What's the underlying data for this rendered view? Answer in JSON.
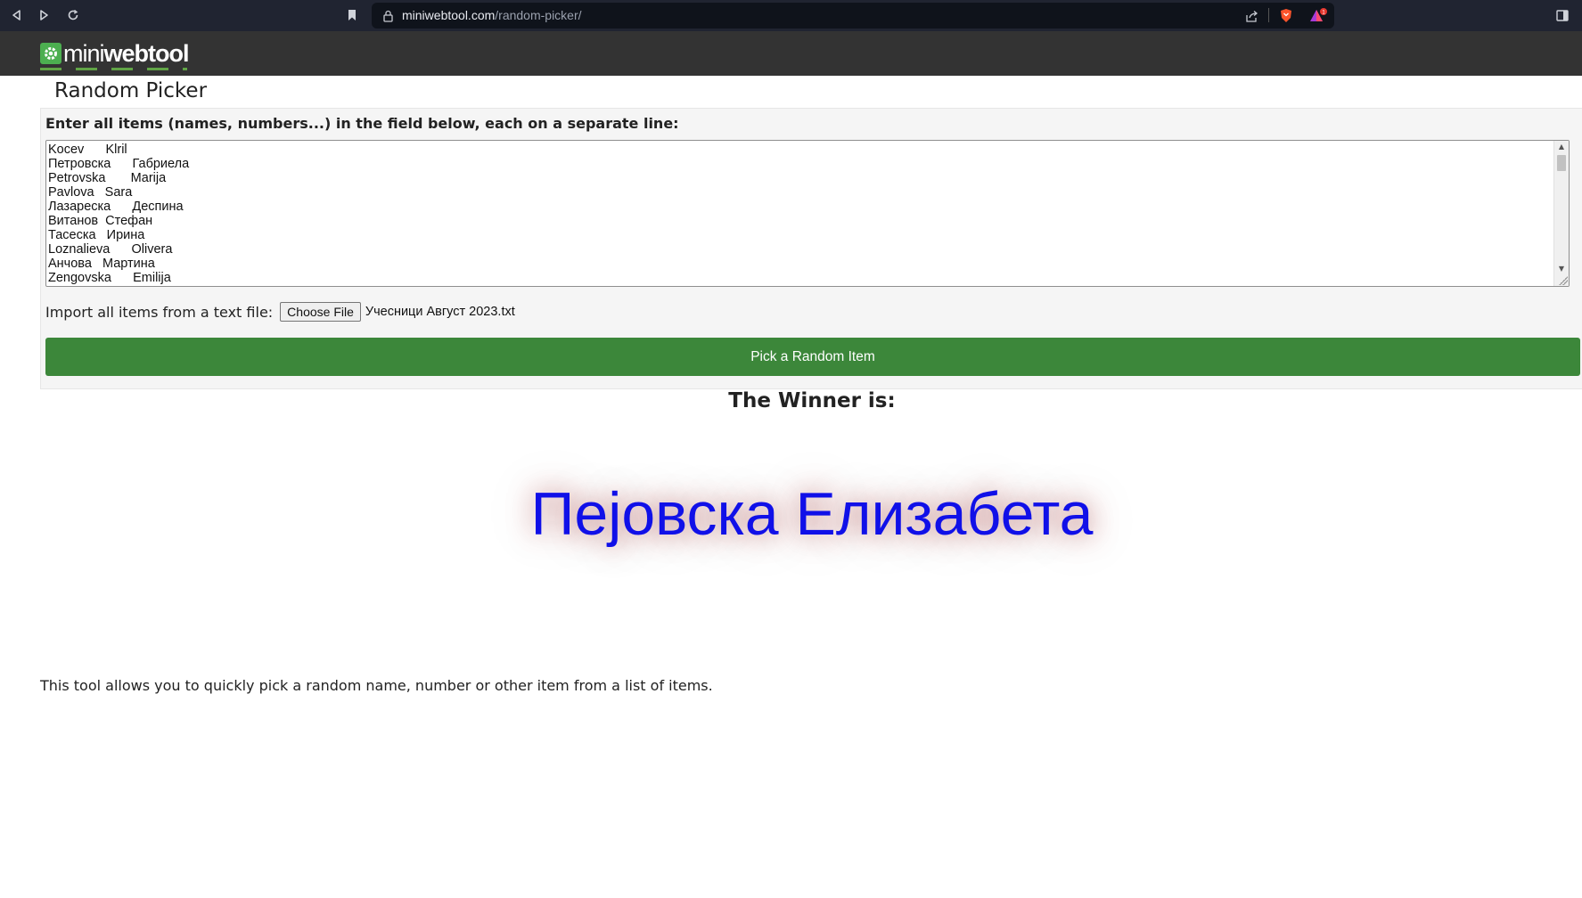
{
  "browser": {
    "url_domain": "miniwebtool.com",
    "url_path": "/random-picker/"
  },
  "site": {
    "logo_light": "mini",
    "logo_bold": "webtool"
  },
  "page": {
    "title": "Random Picker",
    "instructions": "Enter all items (names, numbers...) in the field below, each on a separate line:",
    "items": [
      "Kocev      Klril",
      "Петровска      Габриела",
      "Petrovska       Marija",
      "Pavlova   Sara",
      "Лазареска      Деспина",
      "Витанов  Стефан",
      "Тасеска   Ирина",
      "Loznalieva      Olivera",
      "Анчова   Мартина",
      "Zengovska      Emilija"
    ],
    "import_label": "Import all items from a text file:",
    "choose_file_label": "Choose File",
    "file_name": "Учесници Август 2023.txt",
    "pick_button_label": "Pick a Random Item",
    "winner_label": "The Winner is:",
    "winner_name": "Пејовска Елизабета",
    "description": "This tool allows you to quickly pick a random name, number or other item from a list of items."
  },
  "colors": {
    "accent_green": "#3c873a",
    "winner_blue": "#1010e8",
    "header_dark": "#333333"
  }
}
